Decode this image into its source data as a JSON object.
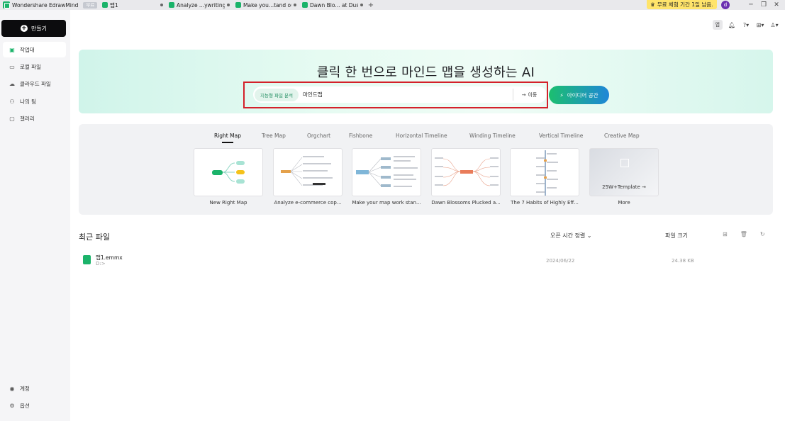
{
  "app": {
    "name": "Wondershare EdrawMind",
    "badge": "무료"
  },
  "tabs": [
    {
      "label": "맵1"
    },
    {
      "label": "Analyze ...ywriting"
    },
    {
      "label": "Make you...tand out"
    },
    {
      "label": "Dawn Blo... at Dusk"
    }
  ],
  "trial": {
    "text": "무료 체험 기간 1일 남음."
  },
  "user": {
    "initial": "d"
  },
  "window": {
    "minimize": "─",
    "restore": "❐",
    "close": "✕"
  },
  "sidebar": {
    "create_label": "만들기",
    "items": [
      {
        "label": "작업대"
      },
      {
        "label": "로컬 파일"
      },
      {
        "label": "클라우드 파일"
      },
      {
        "label": "나의 팀"
      },
      {
        "label": "갤러리"
      }
    ],
    "account": "계정",
    "options": "옵션"
  },
  "topbar": {
    "app_label": "앱"
  },
  "hero": {
    "title": "클릭 한 번으로 마인드 맵을 생성하는 AI",
    "chip": "지능형 파일 분석",
    "input_value": "마인드맵",
    "go_label": "이동",
    "idea_label": "아이디어 공간"
  },
  "templates": {
    "tabs": [
      "Right Map",
      "Tree Map",
      "Orgchart",
      "Fishbone",
      "Horizontal Timeline",
      "Winding Timeline",
      "Vertical Timeline",
      "Creative Map"
    ],
    "active_tab": "Right Map",
    "cards": [
      {
        "label": "New Right Map"
      },
      {
        "label": "Analyze e-commerce cop..."
      },
      {
        "label": "Make your map work stan..."
      },
      {
        "label": "Dawn Blossoms Plucked a..."
      },
      {
        "label": "The 7 Habits of Highly Eff..."
      },
      {
        "label": "More",
        "overlay": "25W+Template"
      }
    ]
  },
  "recent": {
    "title": "최근 파일",
    "sort_label": "오픈 시간 정렬",
    "size_label": "파일 크기",
    "files": [
      {
        "name": "맵1.emmx",
        "path": "D:>",
        "date": "2024/06/22",
        "size": "24.38 KB"
      }
    ]
  },
  "colors": {
    "accent": "#1bb36a",
    "highlight_border": "#d4212a",
    "trial": "#ffe46b"
  }
}
